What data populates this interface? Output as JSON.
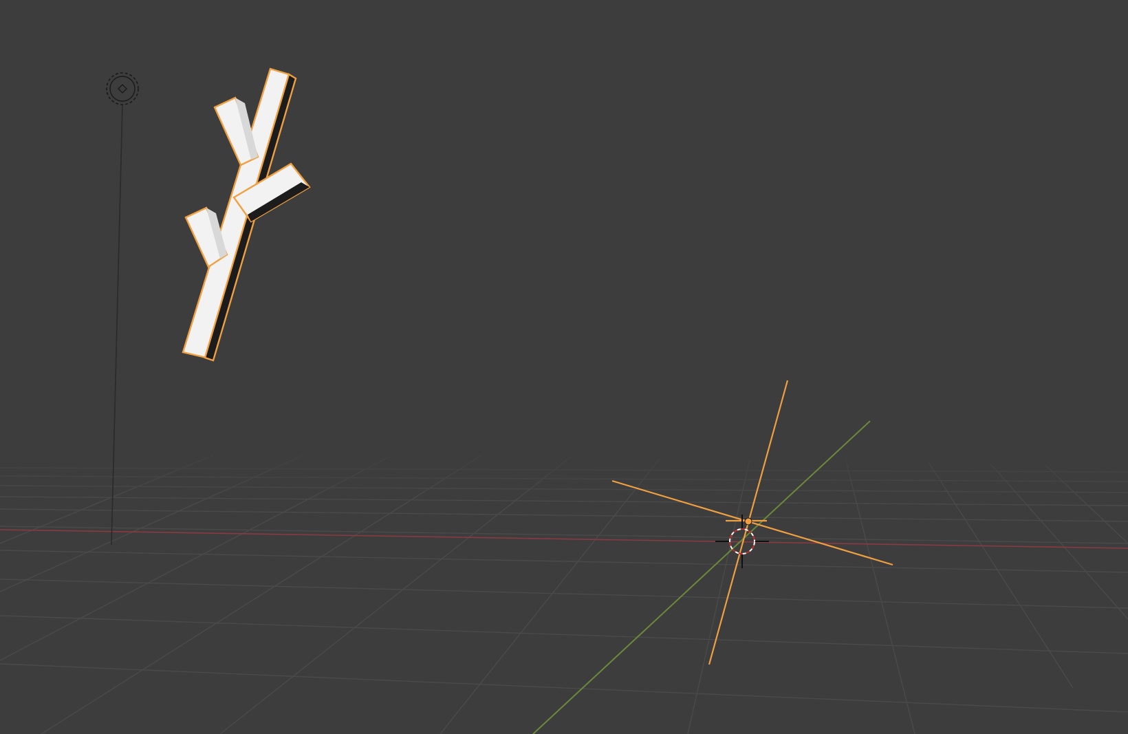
{
  "viewport": {
    "mode": "3d-viewport",
    "background_color": "#3d3d3d",
    "grid_color": "#4a4a4a",
    "x_axis_color": "#8a3a42",
    "y_axis_color": "#6a8a3a",
    "selection_outline_color": "#f0a040",
    "empty_color": "#f0a040",
    "mesh_face_color": "#f2f2f2",
    "mesh_shadow_color": "#1c1c1c"
  },
  "objects": [
    {
      "name": "branch-mesh",
      "type": "mesh",
      "selected": true
    },
    {
      "name": "plain-axes-empty",
      "type": "empty",
      "selected": true
    },
    {
      "name": "light",
      "type": "light",
      "selected": false
    }
  ],
  "cursor": {
    "name": "3d-cursor"
  }
}
